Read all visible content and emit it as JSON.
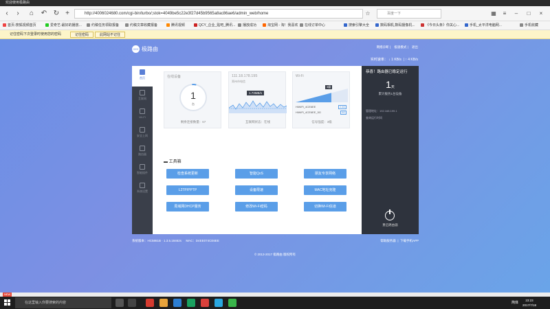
{
  "window": {
    "title": "欢迎使用极路由"
  },
  "nav": {
    "url": "http://4006024680.com/cgi-bin/turbo/;stok=4049be5c22e3f27d45b9565a8ac86ae6/admin_web/home",
    "search_placeholder": "百度一下"
  },
  "bookmarks": [
    {
      "label": "首页-搜狐视频首页"
    },
    {
      "label": "爱奇艺-最好的播放..."
    },
    {
      "label": "约稿任务领取报备"
    },
    {
      "label": "约稿文章收藏报备"
    },
    {
      "label": "腾讯视频"
    },
    {
      "label": "QCY_企业_贴吧_腾讯..."
    },
    {
      "label": "播放成功"
    },
    {
      "label": "淘宝网 - 淘！我喜欢"
    },
    {
      "label": "在线订单中心"
    },
    {
      "label": "搜索引擎大全"
    },
    {
      "label": "数码相机,数码摄像机..."
    },
    {
      "label": "《今日头条》你关心..."
    },
    {
      "label": "手机_太平洋电脑网..."
    },
    {
      "label": "手机收藏"
    }
  ],
  "notice": {
    "text": "记住密码下次登录时使用您的密码",
    "remember_btn": "记住密码",
    "never_btn": "此网站不记住"
  },
  "brand": {
    "name": "极路由",
    "logo_text": "GEE"
  },
  "toplinks": {
    "a": "网络诊断",
    "b": "极速模式",
    "c": "退出"
  },
  "rate": {
    "label": "实时速率：",
    "down": "↓ 1 KB/s",
    "up": "↑ 4 KB/s"
  },
  "sidenav": [
    {
      "label": "首页",
      "icon": "home-icon"
    },
    {
      "label": "互联网",
      "icon": "internet-icon"
    },
    {
      "label": "Wi-Fi",
      "icon": "wifi-icon"
    },
    {
      "label": "安全上网",
      "icon": "shield-icon"
    },
    {
      "label": "路由器",
      "icon": "router-icon"
    },
    {
      "label": "智能插件",
      "icon": "plugin-icon"
    },
    {
      "label": "系统设置",
      "icon": "settings-icon"
    }
  ],
  "devices": {
    "title": "在线设备",
    "count": "1",
    "unit": "台",
    "foot": "剩余连接数量：67"
  },
  "internet": {
    "ip": "111.18.178.195",
    "isp": "郑州市电信",
    "speed": "1.73MB/s",
    "foot": "互联网状态：在线"
  },
  "wifi": {
    "title": "Wi-Fi",
    "strength_level": 3,
    "strength_label": "3级",
    "ssid1": "HiWiFi_4CE6EE",
    "band1": "2.4G",
    "ssid2": "HiWiFi_4CE6EE_5G",
    "band2": "5G",
    "foot": "信号强度：3级"
  },
  "status": {
    "headline": "恭喜！路由器已稳定运行",
    "days": "1",
    "day_unit": "天",
    "served": "累计服务1台设备",
    "addr_label": "管理地址：192.168.199.1",
    "history": "查询运行时间",
    "power": "重启路由器"
  },
  "tools": {
    "title": "工具箱",
    "items": [
      {
        "label": "检查系统更新"
      },
      {
        "label": "智能QoS"
      },
      {
        "label": "朋友专享网络"
      },
      {
        "label": "L2TP/PPTP"
      },
      {
        "label": "设备限速"
      },
      {
        "label": "MAC地址克隆"
      },
      {
        "label": "局域网DHCP服务"
      },
      {
        "label": "修改Wi-Fi密码"
      },
      {
        "label": "切换Wi-Fi信道"
      }
    ]
  },
  "footer": {
    "version": "系统版本：HC5861B · 1.3.5.18462s",
    "mac": "MAC：D4EE074CE6EE",
    "help": "帮助服务器",
    "app": "下载手机APP",
    "copyright": "© 2013-2017 极路由 版权所有"
  },
  "strip": {
    "tag": "NEW"
  },
  "taskbar": {
    "search": "在这里输入你要搜索的内容",
    "lang": "简体",
    "time": "23:23",
    "date": "2017/7/18"
  }
}
